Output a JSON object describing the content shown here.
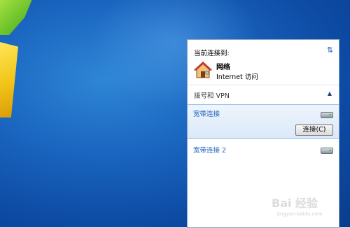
{
  "panel": {
    "current_connection_label": "当前连接到:",
    "network": {
      "name": "网络",
      "access": "Internet 访问"
    },
    "vpn_section_label": "拨号和 VPN",
    "connections": [
      {
        "name": "宽带连接",
        "selected": true,
        "button_label": "连接(C)"
      },
      {
        "name": "宽带连接 2",
        "selected": false
      }
    ]
  },
  "watermark": {
    "main": "Bai 经验",
    "sub": "jingyan.baidu.com"
  },
  "colors": {
    "link_blue": "#1b5fbd",
    "selection_bg": "#dbe9f8",
    "desktop_blue": "#1a66c0"
  }
}
